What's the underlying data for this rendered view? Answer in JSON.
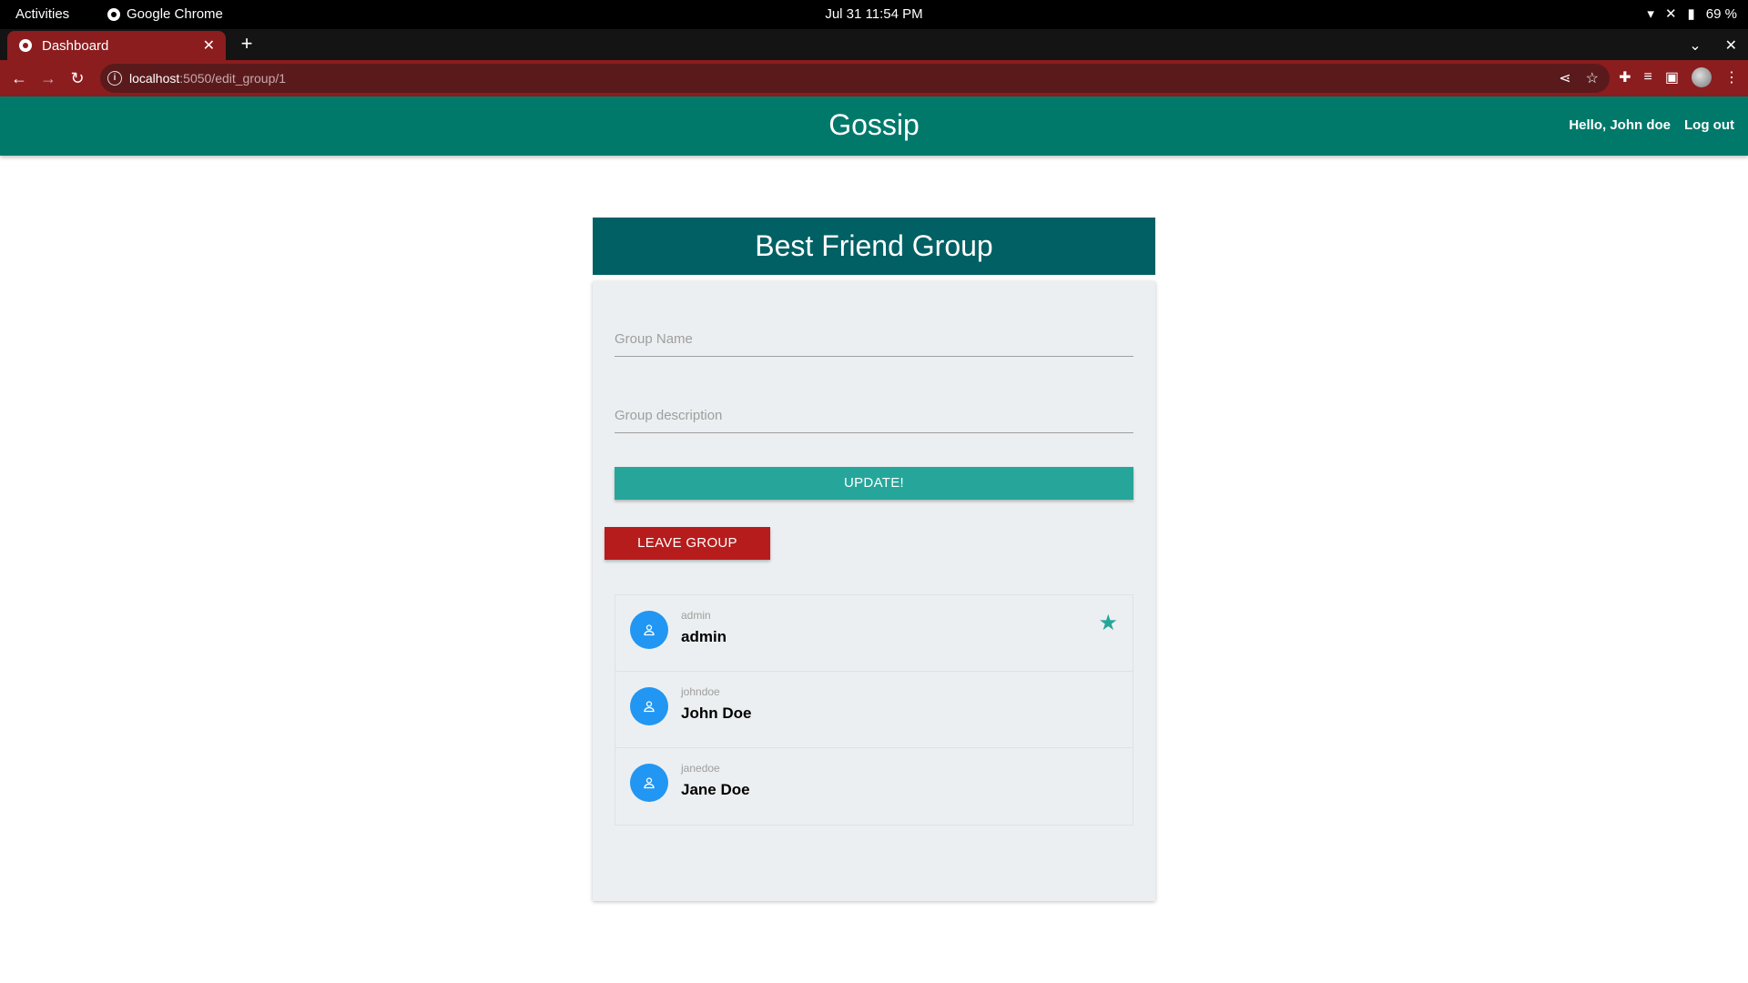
{
  "system": {
    "activities": "Activities",
    "app_name": "Google Chrome",
    "clock": "Jul 31  11:54 PM",
    "battery": "69 %"
  },
  "browser": {
    "tab_title": "Dashboard",
    "url_host": "localhost",
    "url_path": ":5050/edit_group/1"
  },
  "header": {
    "brand": "Gossip",
    "greeting": "Hello, John doe",
    "logout": "Log out"
  },
  "group": {
    "title": "Best Friend Group",
    "name_placeholder": "Group Name",
    "description_placeholder": "Group description",
    "update_label": "UPDATE!",
    "leave_label": "LEAVE GROUP"
  },
  "members": [
    {
      "username": "admin",
      "name": "admin",
      "is_admin": true
    },
    {
      "username": "johndoe",
      "name": "John Doe",
      "is_admin": false
    },
    {
      "username": "janedoe",
      "name": "Jane Doe",
      "is_admin": false
    }
  ],
  "colors": {
    "appbar": "#00796b",
    "card_header": "#006064",
    "update_button": "#26a69a",
    "leave_button": "#b71c1c",
    "avatar": "#2196f3",
    "browser_accent": "#8b1d1f"
  }
}
